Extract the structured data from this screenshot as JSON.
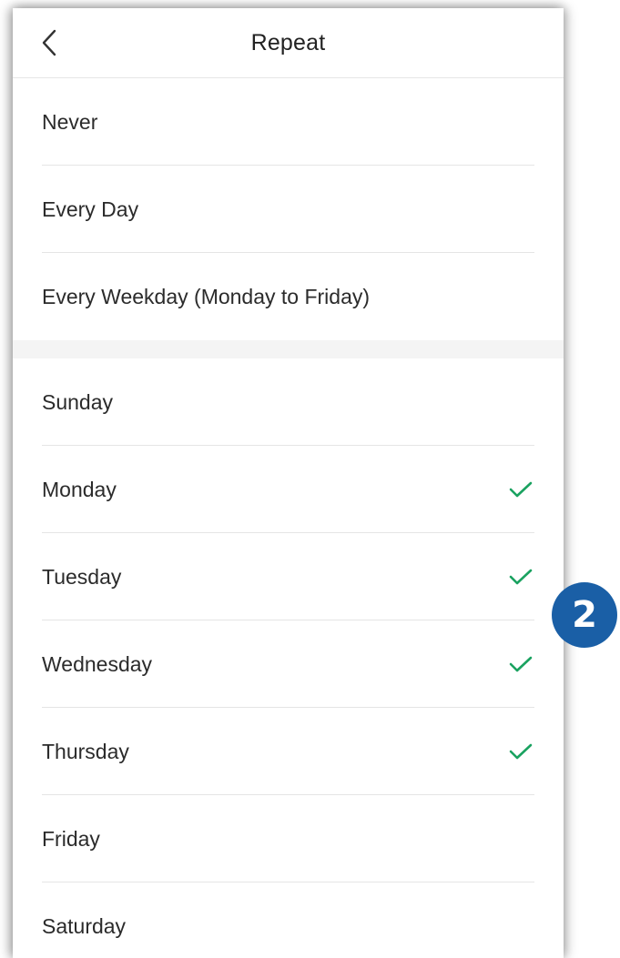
{
  "header": {
    "title": "Repeat",
    "back_icon": "chevron-left-icon"
  },
  "presets": [
    {
      "label": "Never",
      "selected": false
    },
    {
      "label": "Every Day",
      "selected": false
    },
    {
      "label": "Every Weekday (Monday to Friday)",
      "selected": false
    }
  ],
  "days": [
    {
      "label": "Sunday",
      "selected": false
    },
    {
      "label": "Monday",
      "selected": true
    },
    {
      "label": "Tuesday",
      "selected": true
    },
    {
      "label": "Wednesday",
      "selected": true
    },
    {
      "label": "Thursday",
      "selected": true
    },
    {
      "label": "Friday",
      "selected": false
    },
    {
      "label": "Saturday",
      "selected": false
    }
  ],
  "annotation": {
    "badge_number": "2",
    "badge_color": "#1a5fa6"
  },
  "colors": {
    "check": "#1aa260",
    "text": "#2b2b2b",
    "divider": "#e5e5e5",
    "section_gap": "#f4f4f4"
  }
}
